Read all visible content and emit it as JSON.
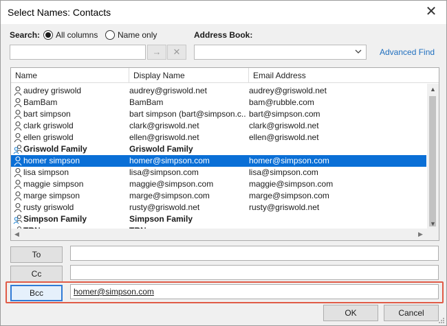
{
  "window": {
    "title": "Select Names: Contacts",
    "close_glyph": "✕"
  },
  "search": {
    "label": "Search:",
    "options": [
      {
        "label": "All columns",
        "selected": true
      },
      {
        "label": "Name only",
        "selected": false
      }
    ],
    "value": "",
    "go_glyph": "→",
    "clear_glyph": "✕"
  },
  "address_book": {
    "label": "Address Book:",
    "value": "",
    "advanced_find": "Advanced Find"
  },
  "table": {
    "columns": [
      "Name",
      "Display Name",
      "Email Address"
    ],
    "rows": [
      {
        "name": "audrey griswold",
        "display": "audrey@griswold.net",
        "email": "audrey@griswold.net",
        "type": "contact",
        "selected": false
      },
      {
        "name": "BamBam",
        "display": "BamBam",
        "email": "bam@rubble.com",
        "type": "contact",
        "selected": false
      },
      {
        "name": "bart simpson",
        "display": "bart simpson (bart@simpson.c...",
        "email": "bart@simpson.com",
        "type": "contact",
        "selected": false
      },
      {
        "name": "clark griswold",
        "display": "clark@griswold.net",
        "email": "clark@griswold.net",
        "type": "contact",
        "selected": false
      },
      {
        "name": "ellen griswold",
        "display": "ellen@griswold.net",
        "email": "ellen@griswold.net",
        "type": "contact",
        "selected": false
      },
      {
        "name": "Griswold Family",
        "display": "Griswold Family",
        "email": "",
        "type": "group",
        "selected": false
      },
      {
        "name": "homer simpson",
        "display": "homer@simpson.com",
        "email": "homer@simpson.com",
        "type": "contact",
        "selected": true
      },
      {
        "name": "lisa simpson",
        "display": "lisa@simpson.com",
        "email": "lisa@simpson.com",
        "type": "contact",
        "selected": false
      },
      {
        "name": "maggie simpson",
        "display": "maggie@simpson.com",
        "email": "maggie@simpson.com",
        "type": "contact",
        "selected": false
      },
      {
        "name": "marge simpson",
        "display": "marge@simpson.com",
        "email": "marge@simpson.com",
        "type": "contact",
        "selected": false
      },
      {
        "name": "rusty griswold",
        "display": "rusty@griswold.net",
        "email": "rusty@griswold.net",
        "type": "contact",
        "selected": false
      },
      {
        "name": "Simpson Family",
        "display": "Simpson Family",
        "email": "",
        "type": "group",
        "selected": false
      },
      {
        "name": "TRN",
        "display": "TRN",
        "email": "",
        "type": "group",
        "selected": false
      }
    ]
  },
  "recipients": {
    "to_label": "To",
    "to_value": "",
    "cc_label": "Cc",
    "cc_value": "",
    "bcc_label": "Bcc",
    "bcc_value": "homer@simpson.com"
  },
  "buttons": {
    "ok": "OK",
    "cancel": "Cancel"
  },
  "colors": {
    "selection": "#0a6fd6",
    "highlight_border": "#e05a46",
    "link": "#1f6fbf"
  }
}
